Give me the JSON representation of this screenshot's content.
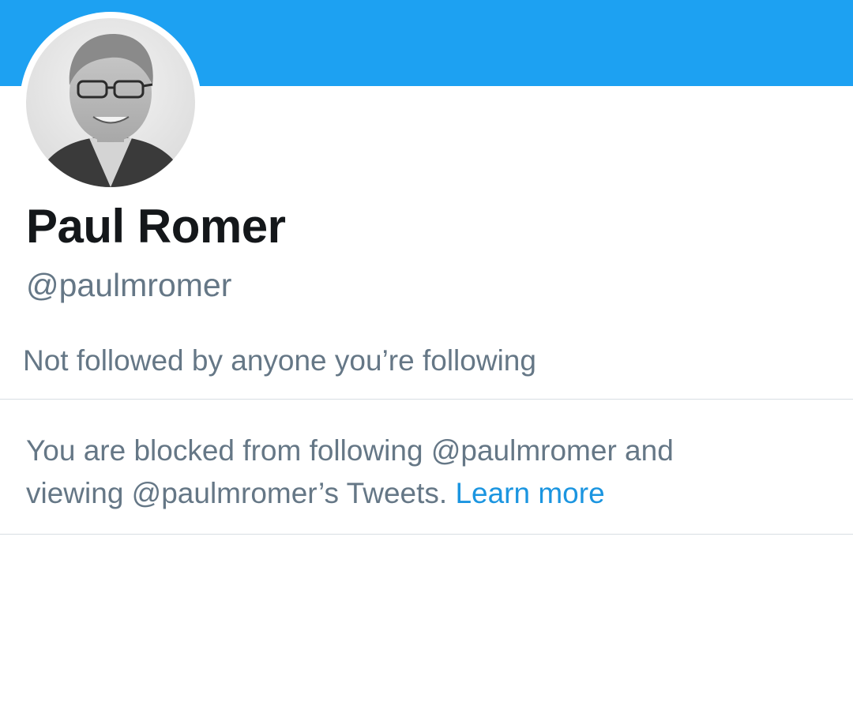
{
  "profile": {
    "name": "Paul Romer",
    "handle": "@paulmromer",
    "avatar_alt": "Paul Romer profile photo",
    "followers_note": "Not followed by anyone you’re following"
  },
  "blocked_notice": {
    "line1": "You are blocked from following @paulmromer and",
    "line2": "viewing @paulmromer’s Tweets.",
    "learn_more_label": "Learn more"
  },
  "colors": {
    "banner": "#1da1f2",
    "link": "#1b95e0",
    "secondary_text": "#657786",
    "primary_text": "#14171a"
  }
}
